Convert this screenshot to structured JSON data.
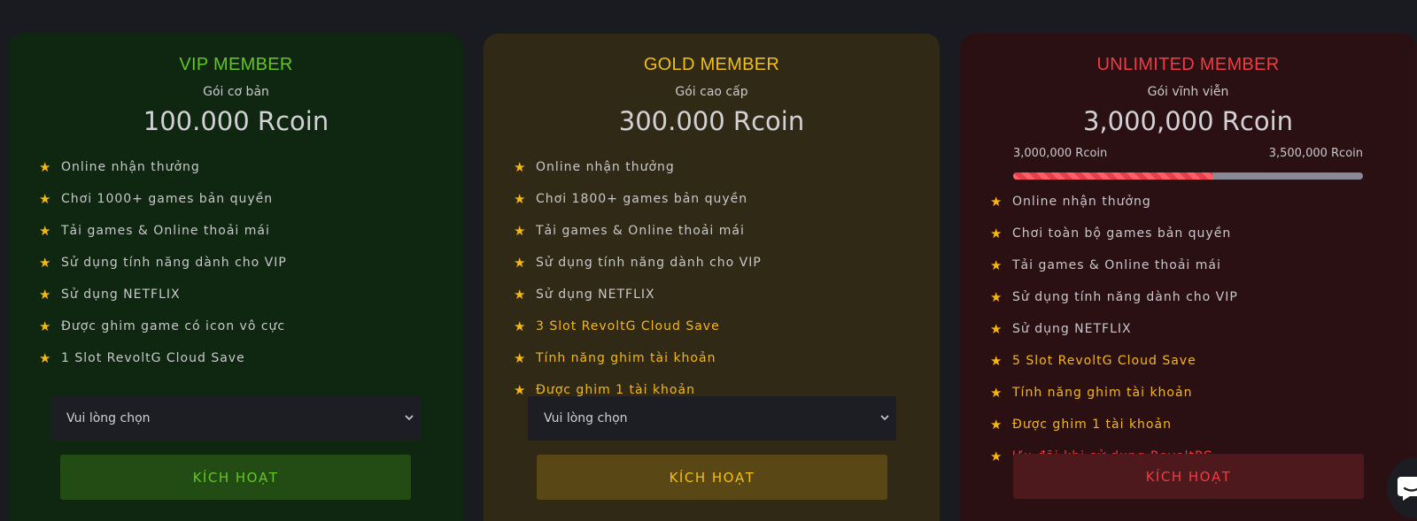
{
  "cards": {
    "vip": {
      "title": "VIP MEMBER",
      "subtitle": "Gói cơ bản",
      "price": "100.000 Rcoin",
      "features": [
        "Online nhận thưởng",
        "Chơi 1000+ games bản quyền",
        "Tải games & Online thoải mái",
        "Sử dụng tính năng dành cho VIP",
        "Sử dụng NETFLIX",
        "Được ghim game có icon vô cực",
        "1 Slot RevoltG Cloud Save"
      ],
      "select_value": "Vui lòng chọn",
      "button_label": "KÍCH HOẠT"
    },
    "gold": {
      "title": "GOLD MEMBER",
      "subtitle": "Gói cao cấp",
      "price": "300.000 Rcoin",
      "features": [
        "Online nhận thưởng",
        "Chơi 1800+ games bản quyền",
        "Tải games & Online thoải mái",
        "Sử dụng tính năng dành cho VIP",
        "Sử dụng NETFLIX",
        "3 Slot RevoltG Cloud Save",
        "Tính năng ghim tài khoản",
        "Được ghim 1 tài khoản"
      ],
      "select_value": "Vui lòng chọn",
      "button_label": "KÍCH HOẠT"
    },
    "unlimited": {
      "title": "UNLIMITED MEMBER",
      "subtitle": "Gói vĩnh viễn",
      "price": "3,000,000 Rcoin",
      "progress": {
        "min_label": "3,000,000 Rcoin",
        "max_label": "3,500,000 Rcoin",
        "fraction": 0.57
      },
      "features": [
        "Online nhận thưởng",
        "Chơi toàn bộ games bản quyền",
        "Tải games & Online thoải mái",
        "Sử dụng tính năng dành cho VIP",
        "Sử dụng NETFLIX",
        "5 Slot RevoltG Cloud Save",
        "Tính năng ghim tài khoản",
        "Được ghim 1 tài khoản",
        "Ưu đãi khi sử dụng RevoltPC"
      ],
      "button_label": "KÍCH HOẠT"
    }
  },
  "icons": {
    "feature": "star-icon",
    "select": "chevron-down-icon",
    "chat": "chat-icon"
  },
  "colors": {
    "vip_accent": "#64c51f",
    "gold_accent": "#f4c00c",
    "unlimited_accent": "#ef3b42",
    "star": "#f5b813"
  }
}
